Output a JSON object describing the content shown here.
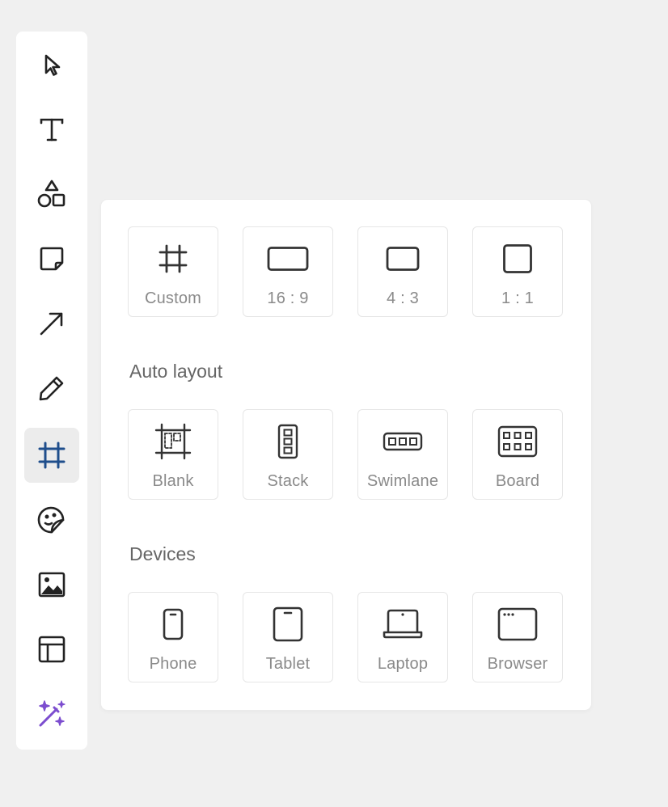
{
  "toolbar": {
    "tools": [
      {
        "icon": "cursor-icon",
        "label": "Select"
      },
      {
        "icon": "text-icon",
        "label": "Text"
      },
      {
        "icon": "shapes-icon",
        "label": "Shapes"
      },
      {
        "icon": "sticky-note-icon",
        "label": "Sticky note"
      },
      {
        "icon": "arrow-icon",
        "label": "Connector"
      },
      {
        "icon": "pencil-icon",
        "label": "Pen"
      },
      {
        "icon": "frame-icon",
        "label": "Frame"
      },
      {
        "icon": "sticker-icon",
        "label": "Stickers"
      },
      {
        "icon": "image-icon",
        "label": "Image"
      },
      {
        "icon": "template-icon",
        "label": "Templates"
      },
      {
        "icon": "magic-wand-icon",
        "label": "AI"
      }
    ],
    "active_tool": "frame-icon",
    "active_color": "#1f4e8c",
    "magic_color": "#7c4dcf"
  },
  "frame_panel": {
    "sizes": [
      {
        "label": "Custom",
        "icon": "frame-icon"
      },
      {
        "label": "16 : 9",
        "icon": "wide-rectangle-icon"
      },
      {
        "label": "4 : 3",
        "icon": "rectangle-icon"
      },
      {
        "label": "1 : 1",
        "icon": "square-icon"
      }
    ],
    "auto_layout_title": "Auto layout",
    "auto_layout": [
      {
        "label": "Blank",
        "icon": "blank-layout-icon"
      },
      {
        "label": "Stack",
        "icon": "stack-layout-icon"
      },
      {
        "label": "Swimlane",
        "icon": "swimlane-layout-icon"
      },
      {
        "label": "Board",
        "icon": "board-layout-icon"
      }
    ],
    "devices_title": "Devices",
    "devices": [
      {
        "label": "Phone",
        "icon": "phone-icon"
      },
      {
        "label": "Tablet",
        "icon": "tablet-icon"
      },
      {
        "label": "Laptop",
        "icon": "laptop-icon"
      },
      {
        "label": "Browser",
        "icon": "browser-icon"
      }
    ]
  }
}
